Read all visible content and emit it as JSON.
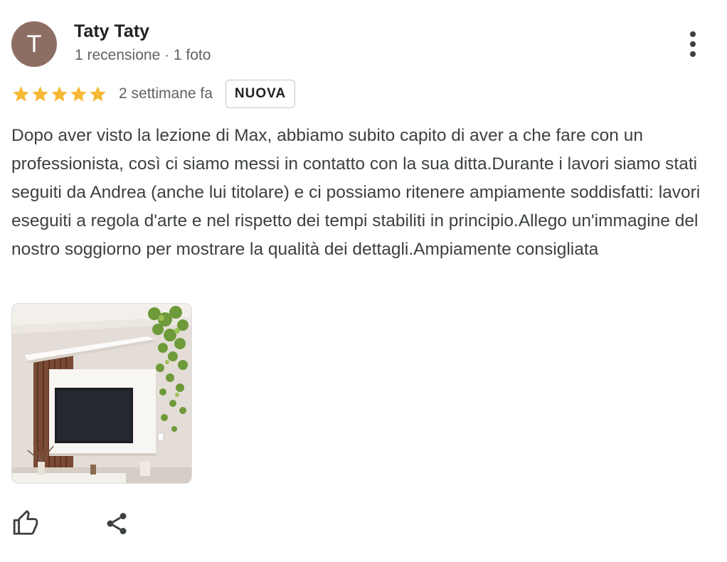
{
  "author": {
    "initial": "T",
    "name": "Taty Taty",
    "meta": "1 recensione · 1 foto"
  },
  "review": {
    "rating": 5,
    "rating_max": 5,
    "date": "2 settimane fa",
    "badge": "NUOVA",
    "text": "Dopo aver visto la lezione di Max, abbiamo subito capito di aver a che fare con un professionista, così ci siamo messi in contatto con la sua ditta.Durante i lavori siamo stati seguiti da Andrea (anche lui titolare) e ci possiamo ritenere ampiamente soddisfatti: lavori eseguiti a regola d'arte e nel rispetto dei tempi stabiliti in principio.Allego un'immagine del nostro soggiorno per mostrare la qualità dei dettagli.Ampiamente consigliata"
  },
  "icons": {
    "more": "more-vert-icon",
    "star": "star-icon",
    "like": "thumb-up-icon",
    "share": "share-icon"
  },
  "colors": {
    "avatar_bg": "#8d6e63",
    "star": "#f6b935",
    "text": "#3c4043",
    "muted": "#5f6368"
  }
}
